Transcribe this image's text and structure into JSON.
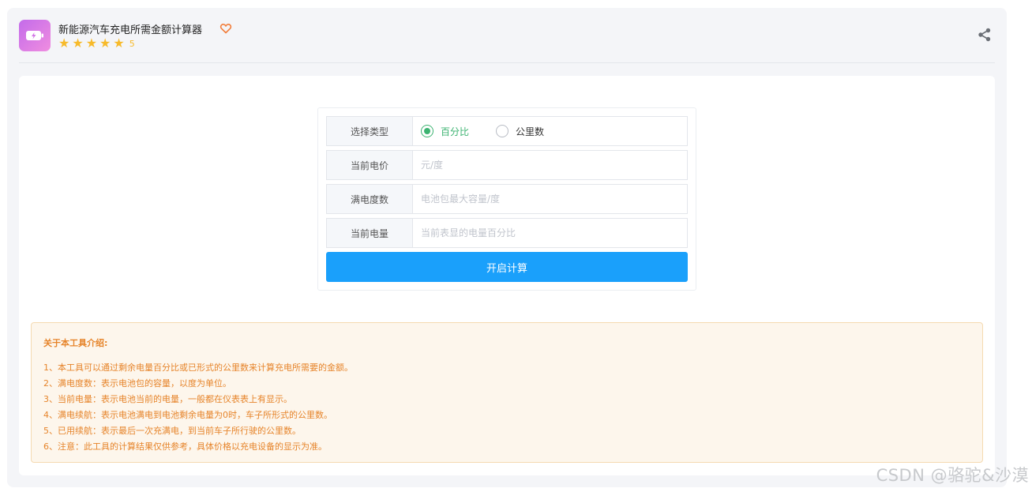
{
  "header": {
    "app_icon": "battery-icon",
    "title": "新能源汽车充电所需金额计算器",
    "favorite_icon": "heart-icon",
    "rating_stars": 5,
    "rating_value": "5",
    "share_icon": "share-icon"
  },
  "form": {
    "rows": [
      {
        "label": "选择类型",
        "type": "radio",
        "options": [
          {
            "label": "百分比",
            "checked": true
          },
          {
            "label": "公里数",
            "checked": false
          }
        ]
      },
      {
        "label": "当前电价",
        "value": "",
        "placeholder": "元/度"
      },
      {
        "label": "满电度数",
        "value": "",
        "placeholder": "电池包最大容量/度"
      },
      {
        "label": "当前电量",
        "value": "",
        "placeholder": "当前表显的电量百分比"
      }
    ],
    "submit_label": "开启计算"
  },
  "notice": {
    "title": "关于本工具介绍:",
    "items": [
      "1、本工具可以通过剩余电量百分比或已形式的公里数来计算充电所需要的金额。",
      "2、满电度数：表示电池包的容量，以度为单位。",
      "3、当前电量：表示电池当前的电量，一般都在仪表表上有显示。",
      "4、满电续航：表示电池满电到电池剩余电量为0时，车子所形式的公里数。",
      "5、已用续航：表示最后一次充满电，到当前车子所行驶的公里数。",
      "6、注意：此工具的计算结果仅供参考，具体价格以充电设备的显示为准。"
    ]
  },
  "watermark": "CSDN @骆驼&沙漠",
  "colors": {
    "accent": "#1aa0fb",
    "radio_checked": "#3cb371",
    "star": "#f7ba2a",
    "notice_text": "#e6842a",
    "notice_bg": "#fdf6ec"
  }
}
